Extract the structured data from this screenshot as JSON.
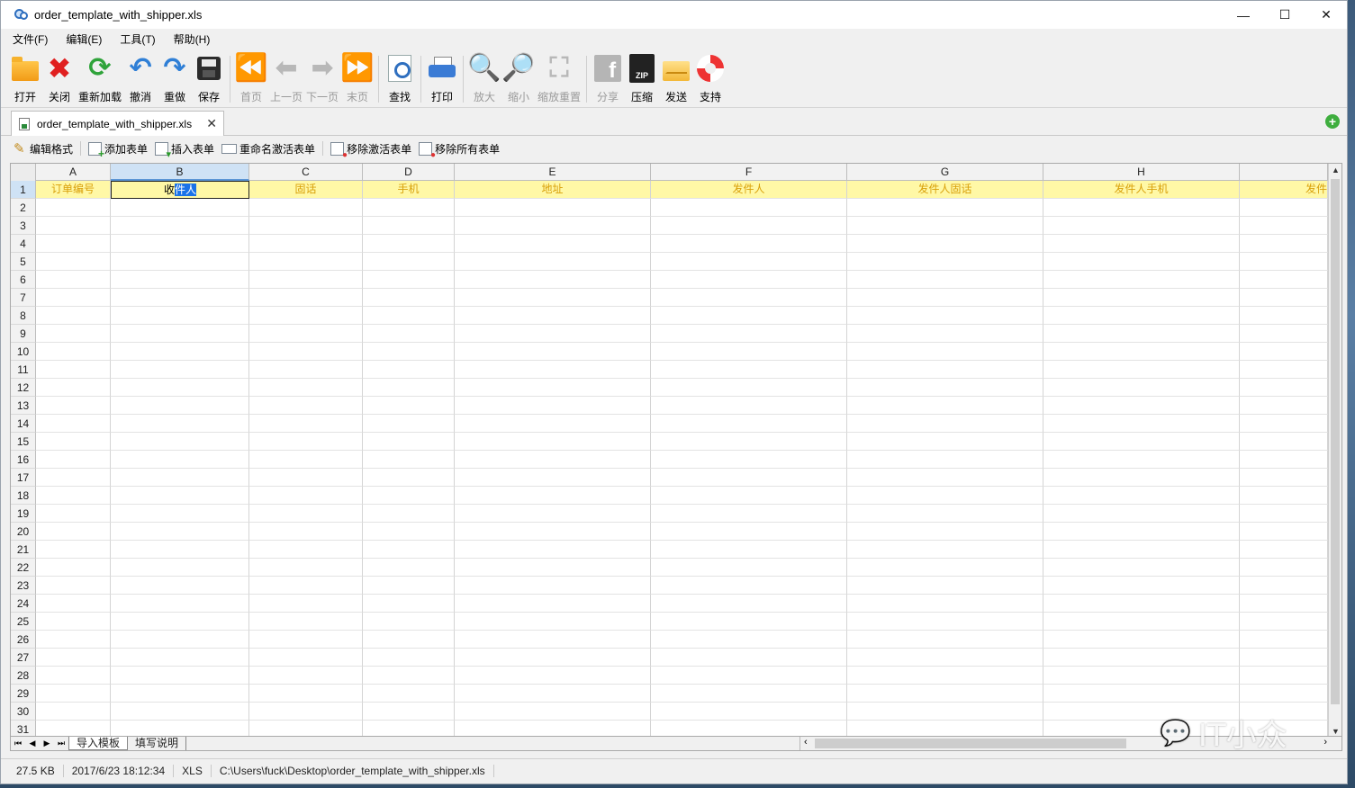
{
  "window": {
    "title": "order_template_with_shipper.xls",
    "controls": {
      "minimize": "—",
      "maximize": "☐",
      "close": "✕"
    }
  },
  "menu": [
    "文件(F)",
    "编辑(E)",
    "工具(T)",
    "帮助(H)"
  ],
  "toolbar": {
    "open": "打开",
    "close": "关闭",
    "reload": "重新加载",
    "undo": "撤消",
    "redo": "重做",
    "save": "保存",
    "first": "首页",
    "prev": "上一页",
    "next": "下一页",
    "last": "末页",
    "find": "查找",
    "print": "打印",
    "zoom_in": "放大",
    "zoom_out": "缩小",
    "zoom_reset": "缩放重置",
    "share": "分享",
    "compress": "压缩",
    "send": "发送",
    "support": "支持"
  },
  "file_tab": {
    "name": "order_template_with_shipper.xls",
    "close": "✕"
  },
  "sheet_actions": {
    "edit_format": "编辑格式",
    "add_sheet": "添加表单",
    "insert_sheet": "插入表单",
    "rename_sheet": "重命名激活表单",
    "remove_active": "移除激活表单",
    "remove_all": "移除所有表单"
  },
  "grid": {
    "columns": [
      "A",
      "B",
      "C",
      "D",
      "E",
      "F",
      "G",
      "H",
      ""
    ],
    "selected_column": "B",
    "selected_row": "1",
    "header_row": {
      "A": "订单编号",
      "B_plain": "收",
      "B_highlighted": "件人",
      "C": "固话",
      "D": "手机",
      "E": "地址",
      "F": "发件人",
      "G": "发件人固话",
      "H": "发件人手机",
      "I": "发件"
    },
    "row_numbers": [
      "1",
      "2",
      "3",
      "4",
      "5",
      "6",
      "7",
      "8",
      "9",
      "10",
      "11",
      "12",
      "13",
      "14",
      "15",
      "16",
      "17",
      "18",
      "19",
      "20",
      "21",
      "22",
      "23",
      "24",
      "25",
      "26",
      "27",
      "28",
      "29",
      "30",
      "31"
    ]
  },
  "sheet_tabs": [
    "导入模板",
    "填写说明"
  ],
  "sheet_nav": {
    "first": "⏮",
    "prev": "◀",
    "next": "▶",
    "last": "⏭"
  },
  "status": {
    "size": "27.5 KB",
    "modified": "2017/6/23 18:12:34",
    "format": "XLS",
    "path": "C:\\Users\\fuck\\Desktop\\order_template_with_shipper.xls"
  },
  "watermark": "IT小众"
}
